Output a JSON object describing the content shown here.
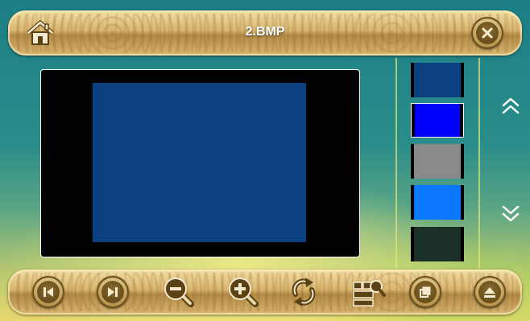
{
  "header": {
    "title": "2.BMP"
  },
  "viewer": {
    "image_color": "#0a3f80"
  },
  "thumbnails": [
    {
      "color": "#0a3f80",
      "selected": false
    },
    {
      "color": "#0000ff",
      "selected": true
    },
    {
      "color": "#8a8a8a",
      "selected": false
    },
    {
      "color": "#0a78ff",
      "selected": false
    },
    {
      "color": "#1b3028",
      "selected": false
    }
  ],
  "controls": [
    "previous-icon",
    "next-icon",
    "zoom-out-icon",
    "zoom-in-icon",
    "rotate-icon",
    "slideshow-settings-icon",
    "window-icon",
    "eject-icon"
  ],
  "colors": {
    "bar_gold": "#d7b56d",
    "icon_dark": "#5a4215",
    "icon_light": "#f3ead0"
  }
}
